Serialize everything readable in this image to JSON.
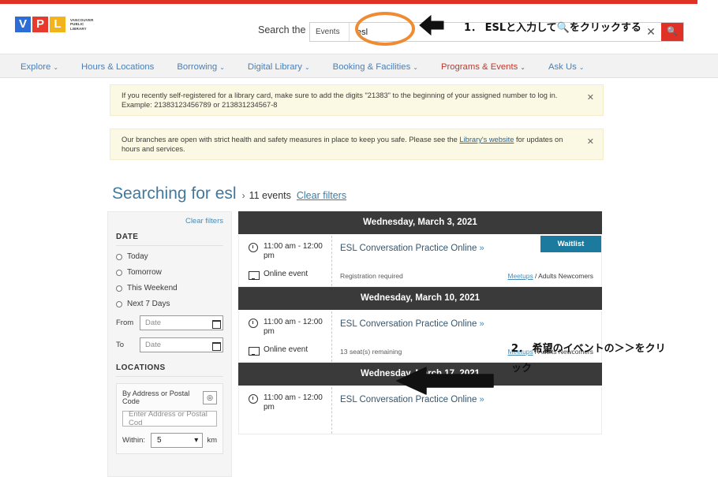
{
  "theme": {
    "accent_red": "#e03127",
    "link_blue": "#4a8bb5",
    "annotation_orange": "#ef8b33",
    "waitlist_teal": "#1b7a9e",
    "day_header_bg": "#3a3a3a"
  },
  "header": {
    "logo": {
      "letters": [
        "V",
        "P",
        "L"
      ],
      "wordmark_line1": "VANCOUVER",
      "wordmark_line2": "PUBLIC",
      "wordmark_line3": "LIBRARY"
    },
    "search_the_label": "Search the",
    "search": {
      "scope_value": "Events",
      "query_value": "esl",
      "placeholder": "",
      "clear_label": "✕",
      "submit_icon": "search-icon"
    }
  },
  "nav": {
    "items": [
      {
        "label": "Explore",
        "caret": true,
        "active": false
      },
      {
        "label": "Hours & Locations",
        "caret": false,
        "active": false
      },
      {
        "label": "Borrowing",
        "caret": true,
        "active": false
      },
      {
        "label": "Digital Library",
        "caret": true,
        "active": false
      },
      {
        "label": "Booking & Facilities",
        "caret": true,
        "active": false
      },
      {
        "label": "Programs & Events",
        "caret": true,
        "active": true
      },
      {
        "label": "Ask Us",
        "caret": true,
        "active": false
      }
    ]
  },
  "alerts": [
    {
      "text": "If you recently self-registered for a library card, make sure to add the digits \"21383\" to the beginning of your assigned number to log in. Example:  21383123456789 or 213831234567-8",
      "close_label": "✕"
    },
    {
      "text_before_link": "Our branches are open with strict health and safety measures in place to keep you safe.  Please see the ",
      "link_text": "Library's website",
      "text_after_link": " for updates on hours and services.",
      "close_label": "✕"
    }
  ],
  "results_heading": {
    "title": "Searching for esl",
    "separator": "›",
    "count_text": "11 events",
    "clear_filters_label": "Clear filters"
  },
  "sidebar": {
    "clear_filters_label": "Clear filters",
    "date_section_title": "DATE",
    "date_options": [
      {
        "label": "Today",
        "selected": false
      },
      {
        "label": "Tomorrow",
        "selected": false
      },
      {
        "label": "This Weekend",
        "selected": false
      },
      {
        "label": "Next 7 Days",
        "selected": false
      }
    ],
    "from_label": "From",
    "from_placeholder": "Date",
    "to_label": "To",
    "to_placeholder": "Date",
    "locations_section_title": "LOCATIONS",
    "by_address_label": "By Address or Postal Code",
    "geolocate_icon": "crosshair-icon",
    "address_placeholder": "Enter Address or Postal Cod",
    "within_label": "Within:",
    "within_value": "5",
    "within_unit": "km"
  },
  "results": [
    {
      "day_header": "Wednesday, March 3, 2021",
      "time": "11:00 am - 12:00 pm",
      "location": "Online event",
      "title": "ESL Conversation Practice Online",
      "chevron": "»",
      "status": "Registration required",
      "tag_link": "Meetups",
      "tag_sep": " / ",
      "tag_text": "Adults Newcomers",
      "badge": "Waitlist"
    },
    {
      "day_header": "Wednesday, March 10, 2021",
      "time": "11:00 am - 12:00 pm",
      "location": "Online event",
      "title": "ESL Conversation Practice Online",
      "chevron": "»",
      "status": "13 seat(s) remaining",
      "tag_link": "Meetups",
      "tag_sep": " / ",
      "tag_text": "Adults Newcomers",
      "badge": ""
    },
    {
      "day_header": "Wednesday, March 17, 2021",
      "time": "11:00 am - 12:00 pm",
      "location": "",
      "title": "ESL Conversation Practice Online",
      "chevron": "»",
      "status": "",
      "tag_link": "",
      "tag_sep": "",
      "tag_text": "",
      "badge": ""
    }
  ],
  "annotations": [
    {
      "id": "step-1",
      "text": "1． ESLと入力して🔍をクリックする"
    },
    {
      "id": "step-2",
      "text": "2． 希望のイベントの＞＞をクリック"
    }
  ]
}
